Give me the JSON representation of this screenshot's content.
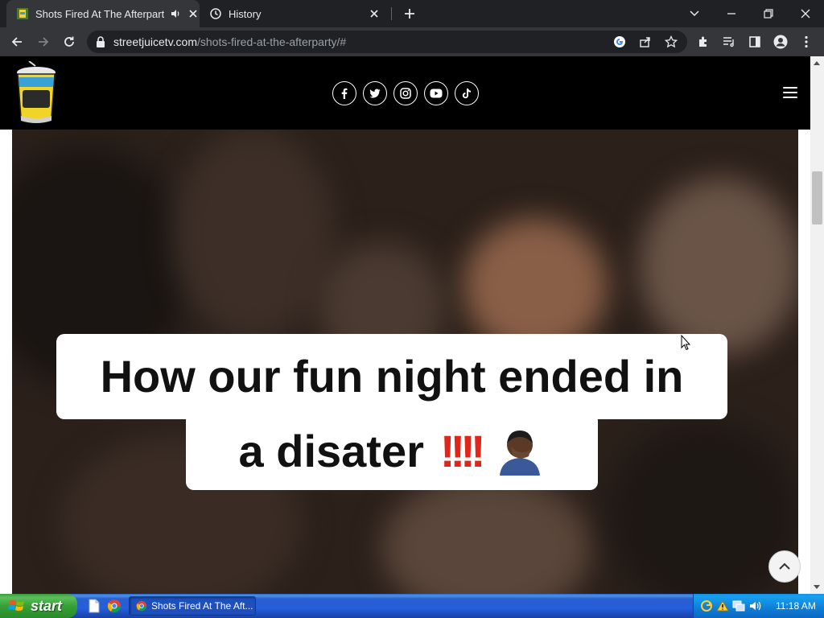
{
  "browser": {
    "tabs": [
      {
        "title": "Shots Fired At The Afterparty",
        "active": true,
        "audio": true
      },
      {
        "title": "History",
        "active": false
      }
    ],
    "url": {
      "host": "streetjuicetv.com",
      "path": "/shots-fired-at-the-afterparty/#"
    }
  },
  "site": {
    "logo_text": "STREET JUICE TV",
    "social_icons": [
      "facebook-icon",
      "twitter-icon",
      "instagram-icon",
      "youtube-icon",
      "tiktok-icon"
    ]
  },
  "video": {
    "caption_line1": "How our fun night ended in",
    "caption_line2": "a disater",
    "caption_emoji": "‼️‼️🤦🏿‍♂️"
  },
  "taskbar": {
    "start_label": "start",
    "task_button": "Shots Fired At The Aft...",
    "clock": "11:18 AM"
  },
  "colors": {
    "chrome_dark": "#202124",
    "chrome_toolbar": "#35363a",
    "site_header": "#000000",
    "caption_red": "#e0251b",
    "xp_blue": "#245edb",
    "xp_green": "#36a036"
  }
}
